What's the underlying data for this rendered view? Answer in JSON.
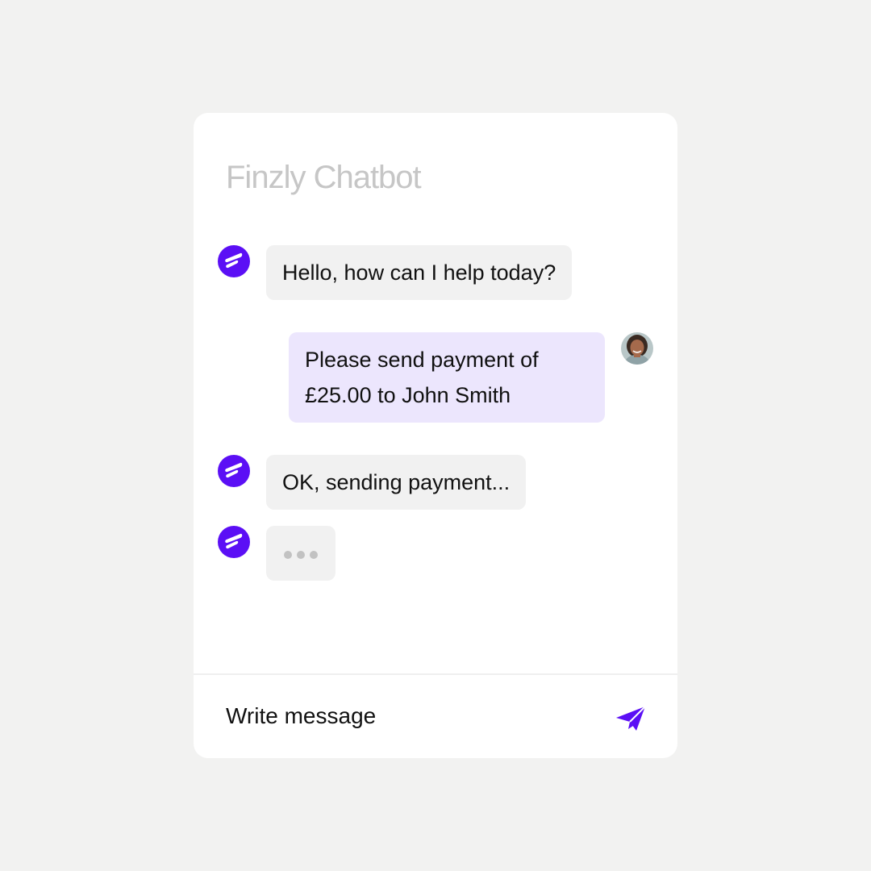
{
  "chat": {
    "title": "Finzly Chatbot",
    "messages": [
      {
        "sender": "bot",
        "text": "Hello, how can I help today?"
      },
      {
        "sender": "user",
        "text": "Please send payment of £25.00 to John Smith"
      },
      {
        "sender": "bot",
        "text": "OK, sending payment..."
      }
    ],
    "typing_indicator": "bot-typing"
  },
  "composer": {
    "placeholder": "Write message",
    "send_icon": "send-icon"
  },
  "colors": {
    "brand": "#5b0ff5",
    "user_bubble": "#ece6fd",
    "bot_bubble": "#f1f1f1",
    "page_background": "#f2f2f1"
  },
  "icons": {
    "bot_avatar": "finzly-logo-icon",
    "user_avatar": "user-avatar"
  }
}
